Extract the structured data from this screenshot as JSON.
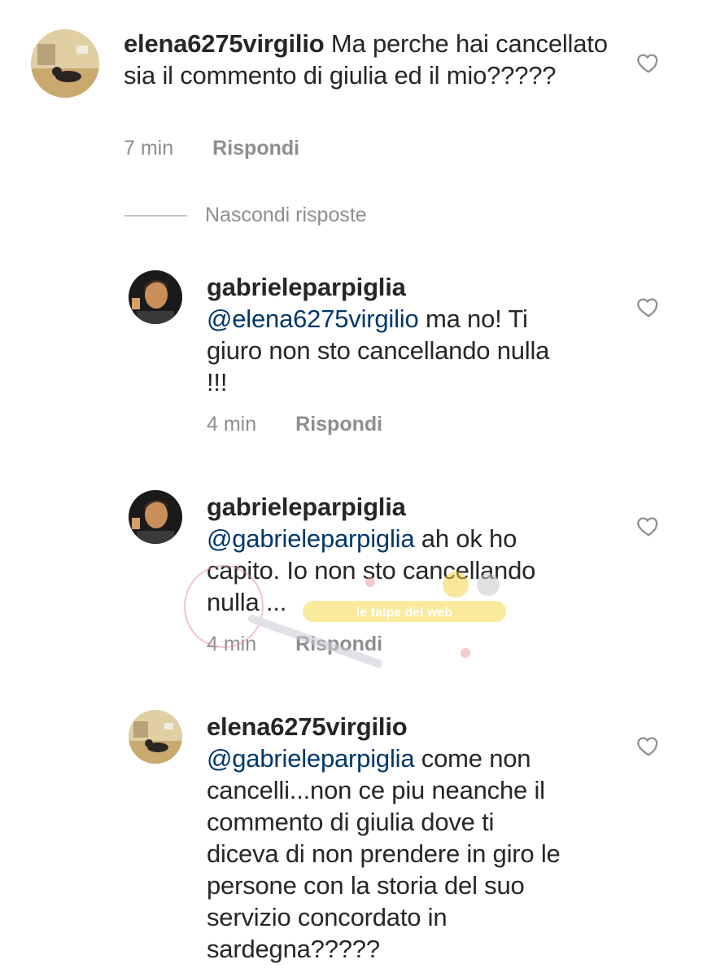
{
  "comments": [
    {
      "username": "elena6275virgilio",
      "mention": "",
      "text": "Ma perche hai cancellato sia il commento di giulia ed il mio?????",
      "time": "7 min",
      "reply_label": "Rispondi"
    },
    {
      "username": "gabrieleparpiglia",
      "mention": "@elena6275virgilio",
      "text": "ma no! Ti giuro non sto cancellando nulla !!!",
      "time": "4 min",
      "reply_label": "Rispondi"
    },
    {
      "username": "gabrieleparpiglia",
      "mention": "@gabrieleparpiglia",
      "text": "ah ok ho capito. Io non sto cancellando nulla ...",
      "time": "4 min",
      "reply_label": "Rispondi"
    },
    {
      "username": "elena6275virgilio",
      "mention": "@gabrieleparpiglia",
      "text": "come non cancelli...non ce piu neanche il commento di giulia dove ti diceva di non prendere in giro le persone con la storia del suo servizio concordato in sardegna?????",
      "time": "",
      "reply_label": ""
    }
  ],
  "hide_replies_label": "Nascondi risposte",
  "watermark": {
    "text": "le talpe del web"
  },
  "colors": {
    "mention": "#00376b",
    "meta": "#8e8e8e",
    "text": "#262626"
  }
}
